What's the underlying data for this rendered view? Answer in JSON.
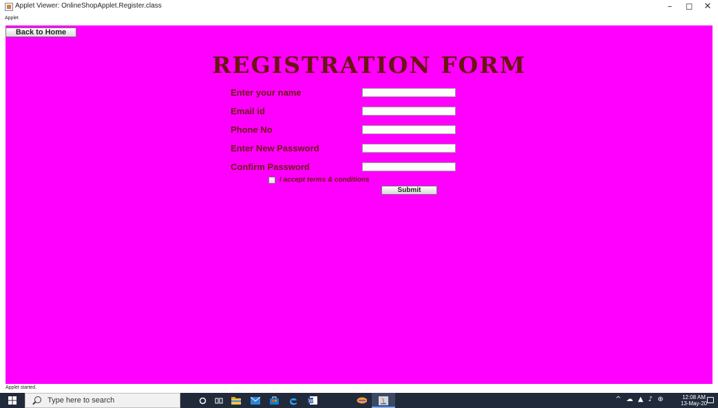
{
  "window": {
    "title": "Applet Viewer: OnlineShopApplet.Register.class",
    "controls": {
      "minimize": "–",
      "maximize": "◻",
      "close": "✕"
    }
  },
  "menubar": {
    "applet_menu": "Applet"
  },
  "applet": {
    "background": "#ff00ff",
    "back_button": "Back to Home",
    "form_title": "REGISTRATION FORM",
    "title_color": "#6a1512",
    "fields": [
      {
        "label": "Enter your name",
        "value": ""
      },
      {
        "label": "Email id",
        "value": ""
      },
      {
        "label": "Phone No",
        "value": ""
      },
      {
        "label": "Enter New Password",
        "value": ""
      },
      {
        "label": "Confirm Password",
        "value": ""
      }
    ],
    "terms_checkbox": {
      "label": "I accept terms & conditions",
      "checked": false
    },
    "submit_button": "Submit"
  },
  "statusbar": {
    "text": "Applet started."
  },
  "taskbar": {
    "search_placeholder": "Type here to search",
    "clock_time": "12:08 AM",
    "clock_date": "13-May-20",
    "pinned_icons": [
      "cortana-icon",
      "task-view-icon",
      "file-explorer-icon",
      "mail-icon",
      "store-icon",
      "edge-icon",
      "word-icon",
      "java-app-icon",
      "java-applet-icon"
    ],
    "tray_icons": [
      "chevron-up-icon",
      "network-icon",
      "wifi-icon",
      "volume-icon",
      "language-icon"
    ]
  }
}
